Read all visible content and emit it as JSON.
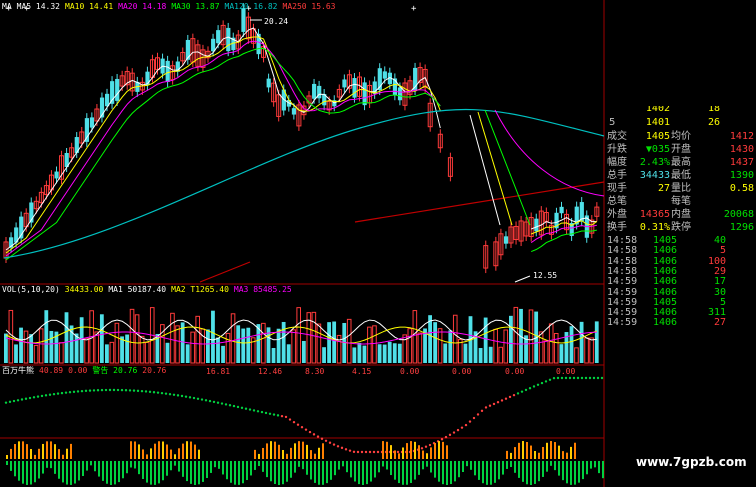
{
  "colors": {
    "up": "#ff3b3b",
    "down": "#4fe0e8",
    "ma5": "#ffffff",
    "ma10": "#ffff00",
    "ma20": "#ff00ff",
    "ma30": "#00ff00",
    "ma120": "#00c0c0",
    "ma250": "#c00000",
    "quote_up": "#ff3b3b",
    "quote_down": "#00e000",
    "label": "#c0c0c0",
    "bull": "#ff4040",
    "bear": "#00d040"
  },
  "ma_legend": [
    {
      "text": "MA",
      "color": "#ffffff"
    },
    {
      "text": "MA5  14.32",
      "color": "#ffffff"
    },
    {
      "text": "MA10 14.41",
      "color": "#ffff00"
    },
    {
      "text": "MA20 14.18",
      "color": "#ff00ff"
    },
    {
      "text": "MA30 13.87",
      "color": "#00ff00"
    },
    {
      "text": "MA120 16.82",
      "color": "#00c0c0"
    },
    {
      "text": "MA250 15.63",
      "color": "#ff3b3b"
    }
  ],
  "price_high_label": "20.24",
  "price_low_label": "12.55",
  "vol_legend": [
    {
      "text": "VOL(5,10,20)",
      "color": "#ffffff"
    },
    {
      "text": "34433.00",
      "color": "#ffff00"
    },
    {
      "text": "MA1 50187.40",
      "color": "#ffffff"
    },
    {
      "text": "MA2 T1265.40",
      "color": "#ffff00"
    },
    {
      "text": "MA3 85485.25",
      "color": "#ff00ff"
    }
  ],
  "ind_legend": [
    {
      "text": "百万牛熊",
      "color": "#ffffff"
    },
    {
      "text": "40.89",
      "color": "#ff3b3b"
    },
    {
      "text": "0.00",
      "color": "#ff3b3b"
    },
    {
      "text": "警告 20.76",
      "color": "#00ff00"
    },
    {
      "text": "20.76",
      "color": "#ff3b3b"
    }
  ],
  "ind_axis_values": [
    "16.81",
    "12.46",
    "8.30",
    "4.15",
    "0.00",
    "0.00",
    "0.00",
    "0.00"
  ],
  "quote_partial": {
    "a": "1402",
    "b": "18",
    "c": "5",
    "d": "1401",
    "e": "26"
  },
  "quotes": [
    {
      "k1": "成交",
      "v1": "1405",
      "c1": "#ffff00",
      "k2": "均价",
      "v2": "1412",
      "c2": "#ff3b3b"
    },
    {
      "k1": "升跌",
      "v1": "▼035",
      "c1": "#00e000",
      "k2": "开盘",
      "v2": "1430",
      "c2": "#ff3b3b"
    },
    {
      "k1": "幅度",
      "v1": "2.43%",
      "c1": "#00e000",
      "k2": "最高",
      "v2": "1437",
      "c2": "#ff3b3b"
    },
    {
      "k1": "总手",
      "v1": "34433",
      "c1": "#4fe0e8",
      "k2": "最低",
      "v2": "1390",
      "c2": "#00e000"
    },
    {
      "k1": "现手",
      "v1": "27",
      "c1": "#ffff00",
      "k2": "量比",
      "v2": "0.58",
      "c2": "#ffff00"
    },
    {
      "k1": "总笔",
      "v1": "",
      "c1": "#ffffff",
      "k2": "每笔",
      "v2": "",
      "c2": "#ffffff"
    },
    {
      "k1": "外盘",
      "v1": "14365",
      "c1": "#ff3b3b",
      "k2": "内盘",
      "v2": "20068",
      "c2": "#00e000"
    },
    {
      "k1": "换手",
      "v1": "0.31%",
      "c1": "#ffff00",
      "k2": "跌停",
      "v2": "1296",
      "c2": "#00e000"
    }
  ],
  "ticks": [
    {
      "time": "14:58",
      "price": "1405",
      "size": "40",
      "pc": "#00e000",
      "sc": "#00e000"
    },
    {
      "time": "14:58",
      "price": "1406",
      "size": "5",
      "pc": "#00e000",
      "sc": "#ff3b3b"
    },
    {
      "time": "14:58",
      "price": "1406",
      "size": "100",
      "pc": "#00e000",
      "sc": "#ff3b3b"
    },
    {
      "time": "14:58",
      "price": "1406",
      "size": "29",
      "pc": "#00e000",
      "sc": "#ff3b3b"
    },
    {
      "time": "14:59",
      "price": "1406",
      "size": "17",
      "pc": "#00e000",
      "sc": "#00e000"
    },
    {
      "time": "14:59",
      "price": "1406",
      "size": "30",
      "pc": "#00e000",
      "sc": "#00e000"
    },
    {
      "time": "14:59",
      "price": "1405",
      "size": "5",
      "pc": "#00e000",
      "sc": "#00e000"
    },
    {
      "time": "14:59",
      "price": "1406",
      "size": "311",
      "pc": "#00e000",
      "sc": "#00e000"
    },
    {
      "time": "14:59",
      "price": "1406",
      "size": "27",
      "pc": "#00e000",
      "sc": "#ff3b3b"
    }
  ],
  "watermark": "www.7gpzb.com"
}
